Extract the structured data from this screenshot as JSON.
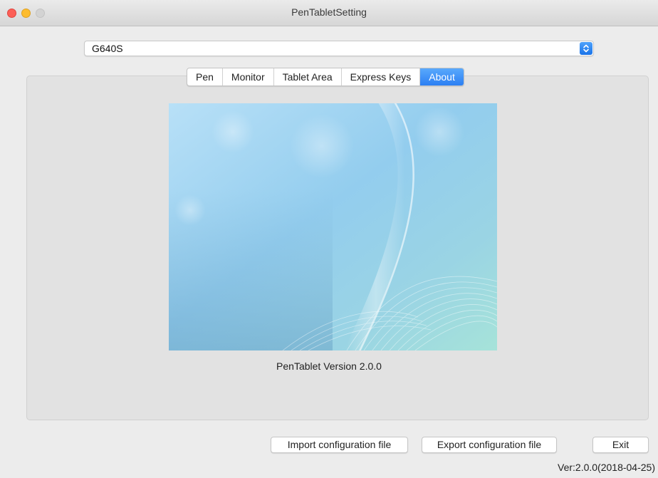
{
  "window": {
    "title": "PenTabletSetting"
  },
  "device": {
    "selected": "G640S"
  },
  "tabs": [
    {
      "label": "Pen",
      "active": false
    },
    {
      "label": "Monitor",
      "active": false
    },
    {
      "label": "Tablet Area",
      "active": false
    },
    {
      "label": "Express Keys",
      "active": false
    },
    {
      "label": "About",
      "active": true
    }
  ],
  "about": {
    "version_text": "PenTablet Version  2.0.0"
  },
  "buttons": {
    "import_label": "Import configuration file",
    "export_label": "Export configuration file",
    "exit_label": "Exit"
  },
  "footer": {
    "version_label": "Ver:2.0.0(2018-04-25)"
  },
  "colors": {
    "accent": "#2b7ff3",
    "close": "#fc5f57",
    "minimize": "#fdbc2e",
    "zoom_disabled": "#d3d3d3"
  },
  "icons": {
    "selector_arrows": "up-down-chevron-icon"
  }
}
